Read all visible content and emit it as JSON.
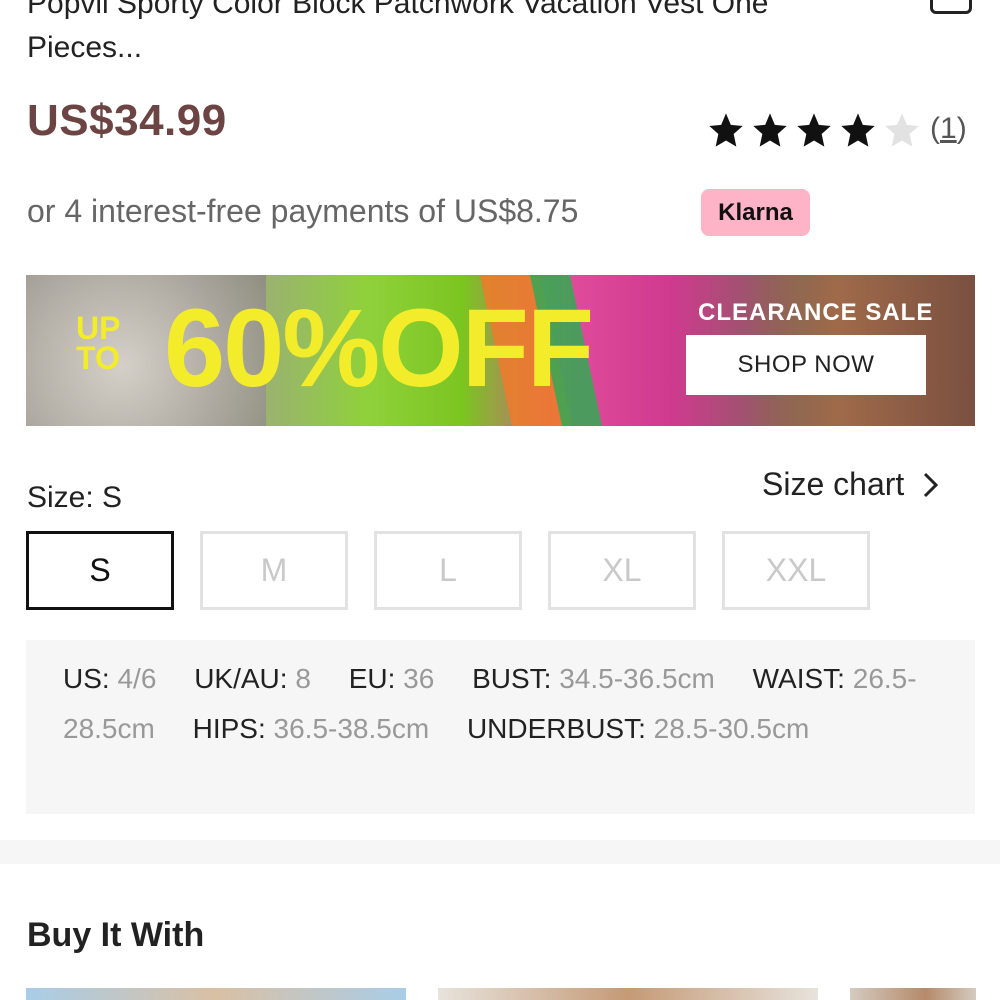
{
  "product": {
    "title_line1": "Popvil Sporty Color Block Patchwork Vacation Vest One",
    "title_line2": "Pieces...",
    "price": "US$34.99",
    "rating": 4,
    "rating_max": 5,
    "review_count_open": "(",
    "review_count": "1",
    "review_count_close": ")",
    "installments_text": "or 4 interest-free payments of US$8.75",
    "klarna_label": "Klarna"
  },
  "banner": {
    "up_to_line1": "UP",
    "up_to_line2": "TO",
    "discount": "60%OFF",
    "clearance": "CLEARANCE SALE",
    "shop_now": "SHOP NOW"
  },
  "sizes": {
    "label": "Size: S",
    "chart_label": "Size chart",
    "options": [
      "S",
      "M",
      "L",
      "XL",
      "XXL"
    ],
    "selected": "S"
  },
  "measurements": {
    "us_key": "US:",
    "us_val": "4/6",
    "uk_key": "UK/AU:",
    "uk_val": "8",
    "eu_key": "EU:",
    "eu_val": "36",
    "bust_key": "BUST:",
    "bust_val": "34.5-36.5cm",
    "waist_key": "WAIST:",
    "waist_val": "26.5-28.5cm",
    "hips_key": "HIPS:",
    "hips_val": "36.5-38.5cm",
    "underbust_key": "UNDERBUST:",
    "underbust_val": "28.5-30.5cm"
  },
  "buy_it_with": {
    "title": "Buy It With"
  },
  "colors": {
    "price": "#6b4443",
    "klarna_bg": "#ffb3c7",
    "banner_text": "#f3ec2a"
  },
  "icons": {
    "bag": "bag-icon",
    "star": "star-icon",
    "chevron": "chevron-right-icon"
  }
}
